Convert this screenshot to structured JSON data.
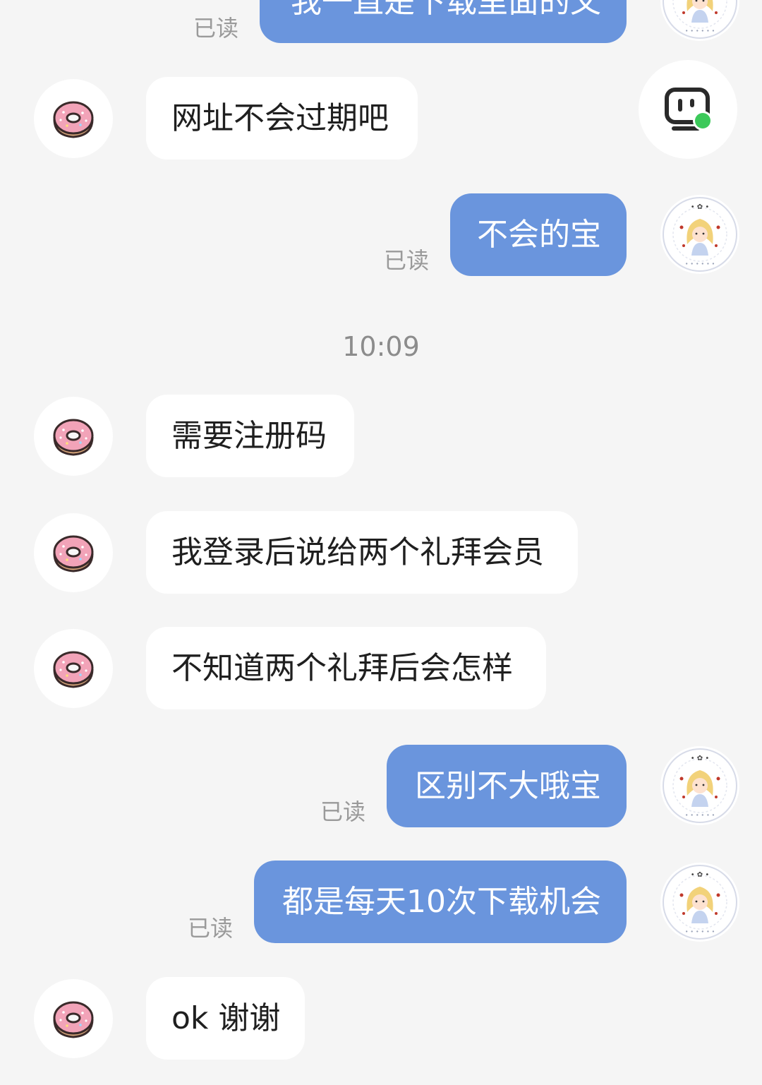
{
  "messages": [
    {
      "side": "out",
      "text": "我一直是下载里面的文",
      "read": "已读"
    },
    {
      "side": "in",
      "text": "网址不会过期吧"
    },
    {
      "side": "out",
      "text": "不会的宝",
      "read": "已读"
    },
    {
      "side": "in",
      "text": "需要注册码"
    },
    {
      "side": "in",
      "text": "我登录后说给两个礼拜会员"
    },
    {
      "side": "in",
      "text": "不知道两个礼拜后会怎样"
    },
    {
      "side": "out",
      "text": "区别不大哦宝",
      "read": "已读"
    },
    {
      "side": "out",
      "text": "都是每天10次下载机会",
      "read": "已读"
    },
    {
      "side": "in",
      "text": "ok 谢谢"
    }
  ],
  "timestamp": "10:09",
  "colors": {
    "outgoing_bubble": "#6a95dd",
    "incoming_bubble": "#ffffff",
    "background": "#f5f5f5",
    "online_dot": "#3cc95a"
  },
  "icons": {
    "contact_avatar": "donut-avatar-icon",
    "my_avatar": "stamp-girl-avatar-icon",
    "assistant_button": "robot-assistant-icon"
  }
}
